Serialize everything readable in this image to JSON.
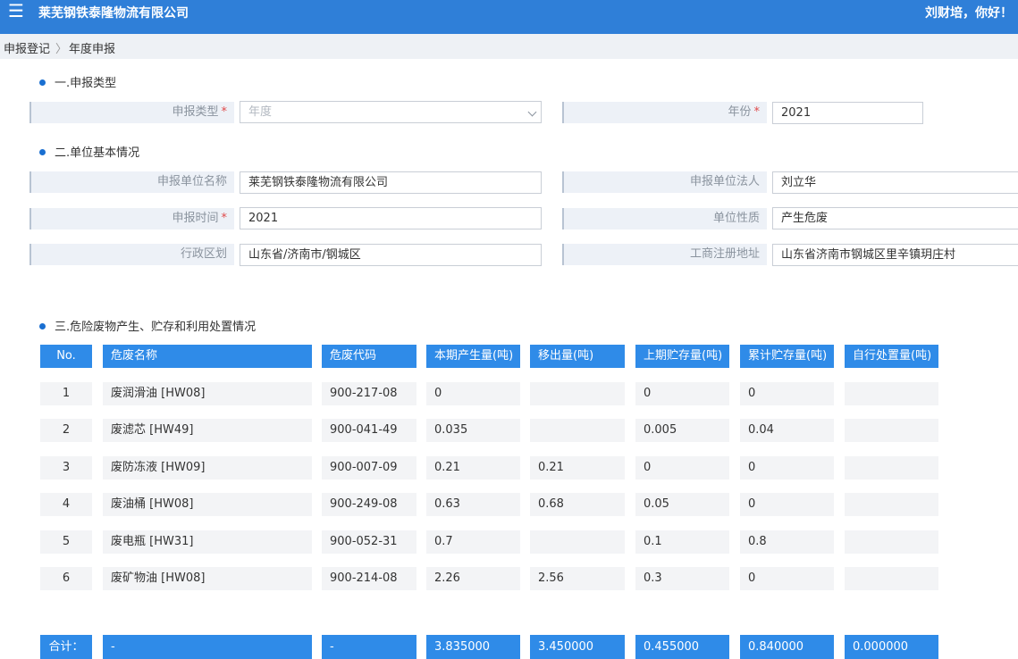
{
  "header": {
    "menu_icon": "☰",
    "company": "莱芜钢铁泰隆物流有限公司",
    "greeting": "刘财培，你好！"
  },
  "breadcrumb": {
    "item1": "申报登记",
    "separator": "〉",
    "item2": "年度申报"
  },
  "section1": {
    "title": "一.申报类型",
    "type_label": "申报类型",
    "type_placeholder": "年度",
    "year_label": "年份",
    "year_value": "2021",
    "required_mark": "*"
  },
  "section2": {
    "title": "二.单位基本情况",
    "org_name_label": "申报单位名称",
    "org_name_value": "莱芜钢铁泰隆物流有限公司",
    "legal_label": "申报单位法人",
    "legal_value": "刘立华",
    "time_label": "申报时间",
    "time_value": "2021",
    "nature_label": "单位性质",
    "nature_value": "产生危废",
    "region_label": "行政区划",
    "region_value": "山东省/济南市/钢城区",
    "address_label": "工商注册地址",
    "address_value": "山东省济南市钢城区里辛镇玥庄村"
  },
  "section3": {
    "title": "三.危险废物产生、贮存和利用处置情况",
    "columns": [
      "No.",
      "危废名称",
      "危废代码",
      "本期产生量(吨)",
      "移出量(吨)",
      "上期贮存量(吨)",
      "累计贮存量(吨)",
      "自行处置量(吨)"
    ],
    "rows": [
      [
        "1",
        "废润滑油 [HW08]",
        "900-217-08",
        "0",
        "",
        "0",
        "0",
        ""
      ],
      [
        "2",
        "废滤芯 [HW49]",
        "900-041-49",
        "0.035",
        "",
        "0.005",
        "0.04",
        ""
      ],
      [
        "3",
        "废防冻液 [HW09]",
        "900-007-09",
        "0.21",
        "0.21",
        "0",
        "0",
        ""
      ],
      [
        "4",
        "废油桶 [HW08]",
        "900-249-08",
        "0.63",
        "0.68",
        "0.05",
        "0",
        ""
      ],
      [
        "5",
        "废电瓶 [HW31]",
        "900-052-31",
        "0.7",
        "",
        "0.1",
        "0.8",
        ""
      ],
      [
        "6",
        "废矿物油 [HW08]",
        "900-214-08",
        "2.26",
        "2.56",
        "0.3",
        "0",
        ""
      ]
    ],
    "totals": [
      "合计：",
      "-",
      "-",
      "3.835000",
      "3.450000",
      "0.455000",
      "0.840000",
      "0.000000"
    ]
  }
}
